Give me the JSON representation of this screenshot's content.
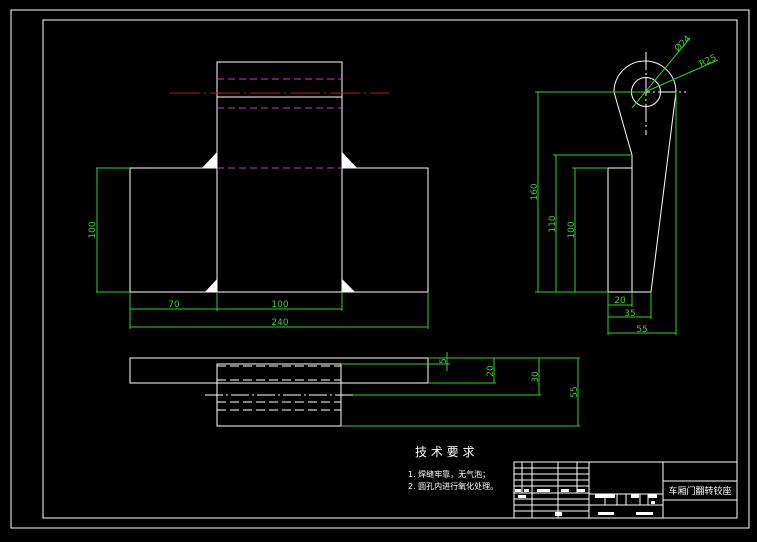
{
  "drawing": {
    "title": "车厢门翻转铰座",
    "requirements": {
      "heading": "技 术 要 求",
      "items": [
        "1. 焊缝牢靠，无气泡；",
        "2. 圆孔内进行氧化处理。"
      ]
    },
    "front_view_dims": {
      "height": "100",
      "left_width": "70",
      "center_width": "100",
      "total_width": "240"
    },
    "side_view_dims": {
      "h160": "160",
      "h110": "110",
      "h100": "100",
      "w20": "20",
      "w35": "35",
      "w55": "55",
      "hole": "Ø24",
      "radius": "R25"
    },
    "top_view_dims": {
      "d5": "5",
      "d20": "20",
      "d30": "30",
      "d55": "55"
    },
    "colors": {
      "background": "#000000",
      "outline": "#ffffff",
      "dimension": "#2fd12f",
      "hidden": "#c040c0",
      "center": "#c01818"
    }
  }
}
